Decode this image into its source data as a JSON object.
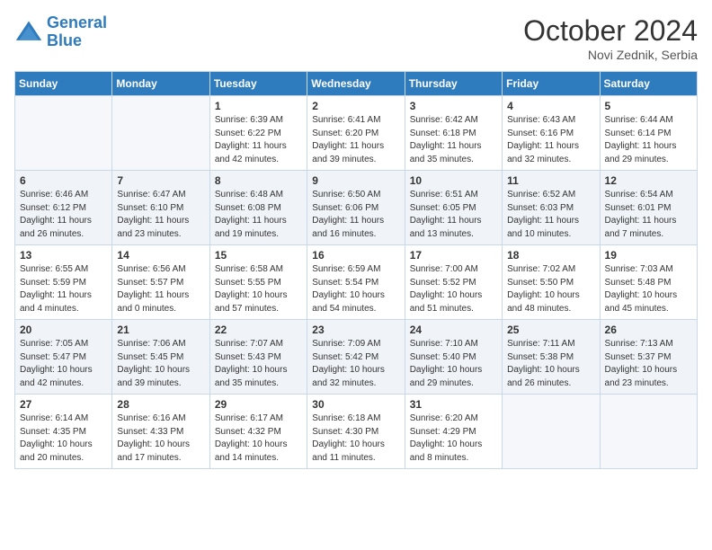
{
  "header": {
    "logo_line1": "General",
    "logo_line2": "Blue",
    "month": "October 2024",
    "location": "Novi Zednik, Serbia"
  },
  "columns": [
    "Sunday",
    "Monday",
    "Tuesday",
    "Wednesday",
    "Thursday",
    "Friday",
    "Saturday"
  ],
  "weeks": [
    [
      {
        "day": "",
        "info": ""
      },
      {
        "day": "",
        "info": ""
      },
      {
        "day": "1",
        "info": "Sunrise: 6:39 AM\nSunset: 6:22 PM\nDaylight: 11 hours and 42 minutes."
      },
      {
        "day": "2",
        "info": "Sunrise: 6:41 AM\nSunset: 6:20 PM\nDaylight: 11 hours and 39 minutes."
      },
      {
        "day": "3",
        "info": "Sunrise: 6:42 AM\nSunset: 6:18 PM\nDaylight: 11 hours and 35 minutes."
      },
      {
        "day": "4",
        "info": "Sunrise: 6:43 AM\nSunset: 6:16 PM\nDaylight: 11 hours and 32 minutes."
      },
      {
        "day": "5",
        "info": "Sunrise: 6:44 AM\nSunset: 6:14 PM\nDaylight: 11 hours and 29 minutes."
      }
    ],
    [
      {
        "day": "6",
        "info": "Sunrise: 6:46 AM\nSunset: 6:12 PM\nDaylight: 11 hours and 26 minutes."
      },
      {
        "day": "7",
        "info": "Sunrise: 6:47 AM\nSunset: 6:10 PM\nDaylight: 11 hours and 23 minutes."
      },
      {
        "day": "8",
        "info": "Sunrise: 6:48 AM\nSunset: 6:08 PM\nDaylight: 11 hours and 19 minutes."
      },
      {
        "day": "9",
        "info": "Sunrise: 6:50 AM\nSunset: 6:06 PM\nDaylight: 11 hours and 16 minutes."
      },
      {
        "day": "10",
        "info": "Sunrise: 6:51 AM\nSunset: 6:05 PM\nDaylight: 11 hours and 13 minutes."
      },
      {
        "day": "11",
        "info": "Sunrise: 6:52 AM\nSunset: 6:03 PM\nDaylight: 11 hours and 10 minutes."
      },
      {
        "day": "12",
        "info": "Sunrise: 6:54 AM\nSunset: 6:01 PM\nDaylight: 11 hours and 7 minutes."
      }
    ],
    [
      {
        "day": "13",
        "info": "Sunrise: 6:55 AM\nSunset: 5:59 PM\nDaylight: 11 hours and 4 minutes."
      },
      {
        "day": "14",
        "info": "Sunrise: 6:56 AM\nSunset: 5:57 PM\nDaylight: 11 hours and 0 minutes."
      },
      {
        "day": "15",
        "info": "Sunrise: 6:58 AM\nSunset: 5:55 PM\nDaylight: 10 hours and 57 minutes."
      },
      {
        "day": "16",
        "info": "Sunrise: 6:59 AM\nSunset: 5:54 PM\nDaylight: 10 hours and 54 minutes."
      },
      {
        "day": "17",
        "info": "Sunrise: 7:00 AM\nSunset: 5:52 PM\nDaylight: 10 hours and 51 minutes."
      },
      {
        "day": "18",
        "info": "Sunrise: 7:02 AM\nSunset: 5:50 PM\nDaylight: 10 hours and 48 minutes."
      },
      {
        "day": "19",
        "info": "Sunrise: 7:03 AM\nSunset: 5:48 PM\nDaylight: 10 hours and 45 minutes."
      }
    ],
    [
      {
        "day": "20",
        "info": "Sunrise: 7:05 AM\nSunset: 5:47 PM\nDaylight: 10 hours and 42 minutes."
      },
      {
        "day": "21",
        "info": "Sunrise: 7:06 AM\nSunset: 5:45 PM\nDaylight: 10 hours and 39 minutes."
      },
      {
        "day": "22",
        "info": "Sunrise: 7:07 AM\nSunset: 5:43 PM\nDaylight: 10 hours and 35 minutes."
      },
      {
        "day": "23",
        "info": "Sunrise: 7:09 AM\nSunset: 5:42 PM\nDaylight: 10 hours and 32 minutes."
      },
      {
        "day": "24",
        "info": "Sunrise: 7:10 AM\nSunset: 5:40 PM\nDaylight: 10 hours and 29 minutes."
      },
      {
        "day": "25",
        "info": "Sunrise: 7:11 AM\nSunset: 5:38 PM\nDaylight: 10 hours and 26 minutes."
      },
      {
        "day": "26",
        "info": "Sunrise: 7:13 AM\nSunset: 5:37 PM\nDaylight: 10 hours and 23 minutes."
      }
    ],
    [
      {
        "day": "27",
        "info": "Sunrise: 6:14 AM\nSunset: 4:35 PM\nDaylight: 10 hours and 20 minutes."
      },
      {
        "day": "28",
        "info": "Sunrise: 6:16 AM\nSunset: 4:33 PM\nDaylight: 10 hours and 17 minutes."
      },
      {
        "day": "29",
        "info": "Sunrise: 6:17 AM\nSunset: 4:32 PM\nDaylight: 10 hours and 14 minutes."
      },
      {
        "day": "30",
        "info": "Sunrise: 6:18 AM\nSunset: 4:30 PM\nDaylight: 10 hours and 11 minutes."
      },
      {
        "day": "31",
        "info": "Sunrise: 6:20 AM\nSunset: 4:29 PM\nDaylight: 10 hours and 8 minutes."
      },
      {
        "day": "",
        "info": ""
      },
      {
        "day": "",
        "info": ""
      }
    ]
  ]
}
